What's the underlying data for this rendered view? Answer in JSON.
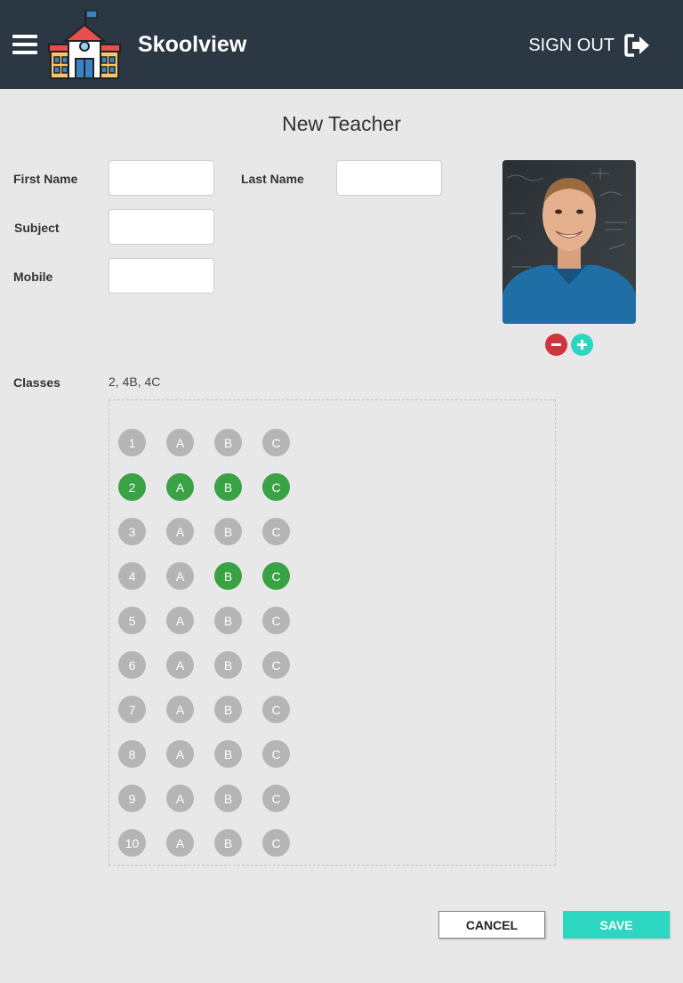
{
  "header": {
    "app_name": "Skoolview",
    "sign_out_label": "SIGN OUT",
    "background_color": "#2b3843"
  },
  "page": {
    "title": "New Teacher"
  },
  "form": {
    "first_name": {
      "label": "First Name",
      "value": ""
    },
    "last_name": {
      "label": "Last Name",
      "value": ""
    },
    "subject": {
      "label": "Subject",
      "value": ""
    },
    "mobile": {
      "label": "Mobile",
      "value": ""
    }
  },
  "photo": {
    "remove_icon": "minus-circle-icon",
    "add_icon": "plus-circle-icon"
  },
  "classes": {
    "label": "Classes",
    "selected_text": "2, 4B, 4C",
    "rows": [
      {
        "chips": [
          {
            "label": "1",
            "on": false
          },
          {
            "label": "A",
            "on": false
          },
          {
            "label": "B",
            "on": false
          },
          {
            "label": "C",
            "on": false
          }
        ]
      },
      {
        "chips": [
          {
            "label": "2",
            "on": true
          },
          {
            "label": "A",
            "on": true
          },
          {
            "label": "B",
            "on": true
          },
          {
            "label": "C",
            "on": true
          }
        ]
      },
      {
        "chips": [
          {
            "label": "3",
            "on": false
          },
          {
            "label": "A",
            "on": false
          },
          {
            "label": "B",
            "on": false
          },
          {
            "label": "C",
            "on": false
          }
        ]
      },
      {
        "chips": [
          {
            "label": "4",
            "on": false
          },
          {
            "label": "A",
            "on": false
          },
          {
            "label": "B",
            "on": true
          },
          {
            "label": "C",
            "on": true
          }
        ]
      },
      {
        "chips": [
          {
            "label": "5",
            "on": false
          },
          {
            "label": "A",
            "on": false
          },
          {
            "label": "B",
            "on": false
          },
          {
            "label": "C",
            "on": false
          }
        ]
      },
      {
        "chips": [
          {
            "label": "6",
            "on": false
          },
          {
            "label": "A",
            "on": false
          },
          {
            "label": "B",
            "on": false
          },
          {
            "label": "C",
            "on": false
          }
        ]
      },
      {
        "chips": [
          {
            "label": "7",
            "on": false
          },
          {
            "label": "A",
            "on": false
          },
          {
            "label": "B",
            "on": false
          },
          {
            "label": "C",
            "on": false
          }
        ]
      },
      {
        "chips": [
          {
            "label": "8",
            "on": false
          },
          {
            "label": "A",
            "on": false
          },
          {
            "label": "B",
            "on": false
          },
          {
            "label": "C",
            "on": false
          }
        ]
      },
      {
        "chips": [
          {
            "label": "9",
            "on": false
          },
          {
            "label": "A",
            "on": false
          },
          {
            "label": "B",
            "on": false
          },
          {
            "label": "C",
            "on": false
          }
        ]
      },
      {
        "chips": [
          {
            "label": "10",
            "on": false
          },
          {
            "label": "A",
            "on": false
          },
          {
            "label": "B",
            "on": false
          },
          {
            "label": "C",
            "on": false
          }
        ]
      }
    ],
    "selected_color": "#38a245",
    "unselected_color": "#b5b5b5"
  },
  "actions": {
    "cancel_label": "CANCEL",
    "save_label": "SAVE",
    "save_color": "#2cd6c0"
  }
}
